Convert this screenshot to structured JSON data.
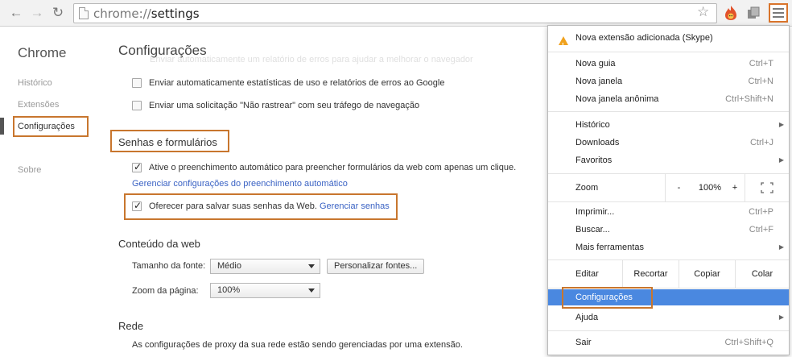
{
  "browser": {
    "url_scheme": "chrome://",
    "url_path": "settings",
    "icons": {
      "back": "arrow-left-icon",
      "forward": "arrow-right-icon",
      "reload": "reload-icon",
      "page": "page-icon",
      "bookmark": "star-icon",
      "extension1": "fire-extension-icon",
      "extension2": "box-extension-icon",
      "menu": "hamburger-menu-icon"
    },
    "highlight_color": "#c8762e"
  },
  "sidebar": {
    "brand": "Chrome",
    "items": [
      {
        "label": "Histórico"
      },
      {
        "label": "Extensões"
      },
      {
        "label": "Configurações"
      },
      {
        "label": "Sobre"
      }
    ]
  },
  "main": {
    "title": "Configurações",
    "faded_text": "Enviar automaticamente um relatório de erros para ajudar a melhorar o navegador",
    "privacy": [
      {
        "label": "Enviar automaticamente estatísticas de uso e relatórios de erros ao Google",
        "checked": false
      },
      {
        "label": "Enviar uma solicitação \"Não rastrear\" com seu tráfego de navegação",
        "checked": false
      }
    ],
    "passwords_section": {
      "title": "Senhas e formulários",
      "autofill_label": "Ative o preenchimento automático para preencher formulários da web com apenas um clique.",
      "autofill_link": "Gerenciar configurações do preenchimento automático",
      "save_passwords_label": "Oferecer para salvar suas senhas da Web.",
      "save_passwords_link": "Gerenciar senhas"
    },
    "web_content": {
      "title": "Conteúdo da web",
      "font_size_label": "Tamanho da fonte:",
      "font_size_value": "Médio",
      "customize_fonts_button": "Personalizar fontes...",
      "page_zoom_label": "Zoom da página:",
      "page_zoom_value": "100%"
    },
    "network": {
      "title": "Rede",
      "text": "As configurações de proxy da sua rede estão sendo gerenciadas por uma extensão."
    }
  },
  "menu": {
    "notification": "Nova extensão adicionada (Skype)",
    "items": [
      {
        "label": "Nova guia",
        "shortcut": "Ctrl+T"
      },
      {
        "label": "Nova janela",
        "shortcut": "Ctrl+N"
      },
      {
        "label": "Nova janela anônima",
        "shortcut": "Ctrl+Shift+N"
      },
      {
        "label": "Histórico",
        "shortcut": ""
      },
      {
        "label": "Downloads",
        "shortcut": "Ctrl+J"
      },
      {
        "label": "Favoritos",
        "shortcut": ""
      },
      {
        "label": "Imprimir...",
        "shortcut": "Ctrl+P"
      },
      {
        "label": "Buscar...",
        "shortcut": "Ctrl+F"
      },
      {
        "label": "Mais ferramentas",
        "shortcut": ""
      },
      {
        "label": "Configurações",
        "shortcut": ""
      },
      {
        "label": "Ajuda",
        "shortcut": ""
      },
      {
        "label": "Sair",
        "shortcut": "Ctrl+Shift+Q"
      }
    ],
    "zoom": {
      "label": "Zoom",
      "minus": "-",
      "value": "100%",
      "plus": "+"
    },
    "edit": {
      "label": "Editar",
      "cut": "Recortar",
      "copy": "Copiar",
      "paste": "Colar"
    }
  }
}
